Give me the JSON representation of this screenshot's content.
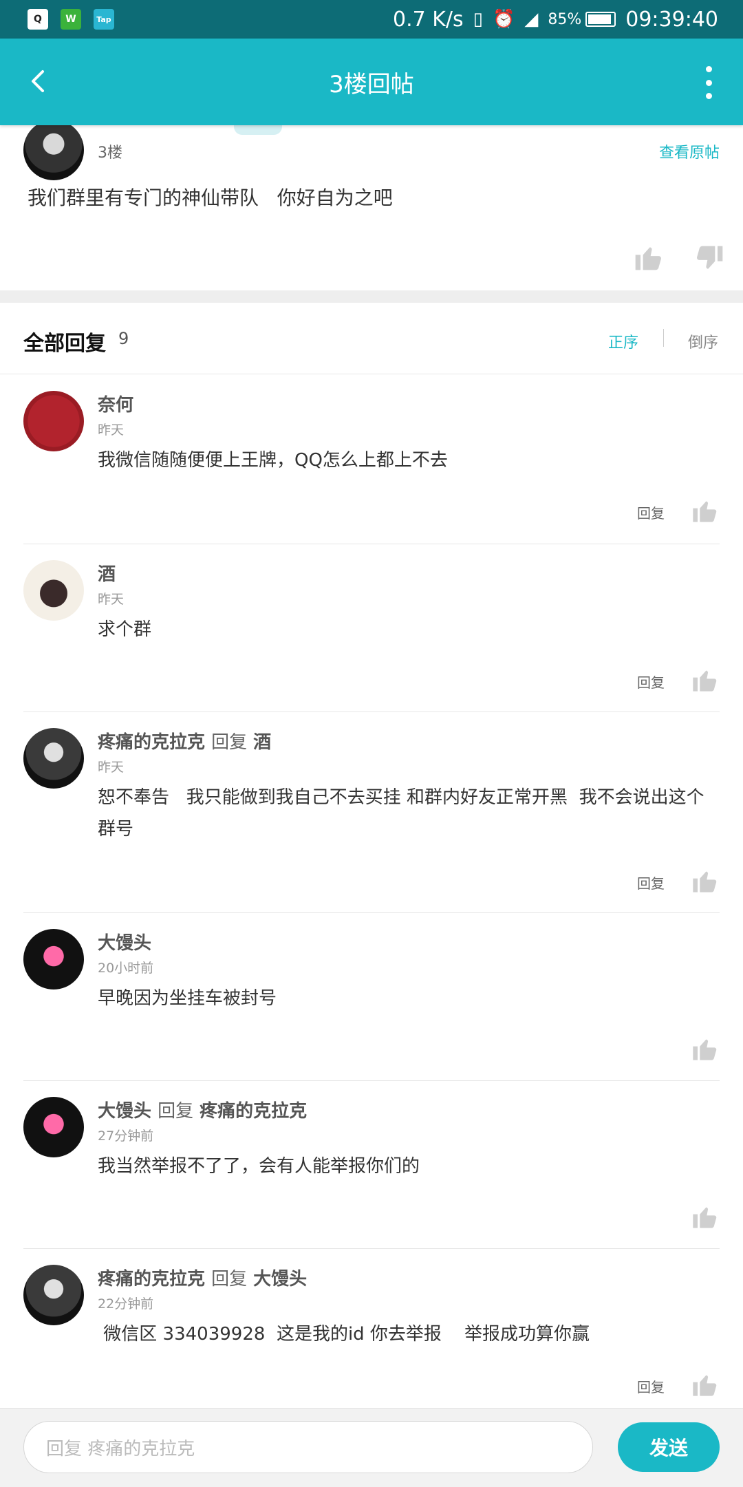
{
  "status_bar": {
    "network_speed": "0.7 K/s",
    "battery": "85%",
    "time": "09:39:40",
    "app_icons": [
      "qq-icon",
      "wechat-icon",
      "taptap-icon"
    ]
  },
  "app_bar": {
    "title": "3楼回帖",
    "icons": [
      "back-arrow-icon",
      "more-vertical-icon"
    ]
  },
  "original_post": {
    "floor": "3楼",
    "view_original": "查看原帖",
    "content": "我们群里有专门的神仙带队   你好自为之吧"
  },
  "replies_header": {
    "title": "全部回复",
    "count": "9",
    "sort_asc": "正序",
    "sort_desc": "倒序"
  },
  "comments": [
    {
      "name": "奈何",
      "time": "昨天",
      "text": "我微信随随便便上王牌，QQ怎么上都上不去",
      "reply_label": "回复"
    },
    {
      "name": "酒",
      "time": "昨天",
      "text": "求个群",
      "reply_label": "回复"
    },
    {
      "name": "疼痛的克拉克",
      "reply_word": "回复",
      "reply_to": "酒",
      "time": "昨天",
      "text": "恕不奉告   我只能做到我自己不去买挂 和群内好友正常开黑  我不会说出这个群号",
      "reply_label": "回复"
    },
    {
      "name": "大馒头",
      "time": "20小时前",
      "text": "早晚因为坐挂车被封号"
    },
    {
      "name": "大馒头",
      "reply_word": "回复",
      "reply_to": "疼痛的克拉克",
      "time": "27分钟前",
      "text": "我当然举报不了了，会有人能举报你们的"
    },
    {
      "name": "疼痛的克拉克",
      "reply_word": "回复",
      "reply_to": "大馒头",
      "time": "22分钟前",
      "text": " 微信区 334039928  这是我的id 你去举报    举报成功算你赢",
      "reply_label": "回复"
    }
  ],
  "input_bar": {
    "placeholder": "回复 疼痛的克拉克",
    "send_label": "发送"
  },
  "colors": {
    "accent": "#1ab8c6",
    "status_bar": "#0d6c76"
  }
}
